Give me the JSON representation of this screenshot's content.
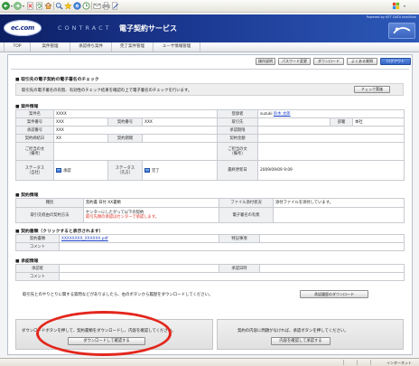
{
  "theme": {
    "header_dark": "#0d1f63",
    "accent_blue": "#3565c8",
    "link": "#1b3fc9",
    "warning_red": "#e02a1f",
    "highlight_ring": "#e3261c"
  },
  "browser": {
    "toolbar_icons": [
      "back-icon",
      "forward-icon",
      "stop-icon",
      "refresh-icon",
      "home-icon",
      "search-icon",
      "favorites-icon",
      "media-icon",
      "history-icon",
      "mail-icon",
      "print-icon",
      "edit-icon",
      "windows-flag-icon"
    ],
    "status_zone": "インターネット"
  },
  "header": {
    "logo": "ec.com",
    "product_prefix": "CONTRACT",
    "product_name": "電子契約サービス",
    "powered_by": "Powered by NTT DATA Intellilink"
  },
  "nav": {
    "tabs": [
      {
        "label": "TOP"
      },
      {
        "label": "案件管理"
      },
      {
        "label": "承認待ち案件"
      },
      {
        "label": "完了案件管理"
      },
      {
        "label": "ユーザ情報管理"
      }
    ]
  },
  "utility": {
    "buttons": [
      {
        "label": "操作説明"
      },
      {
        "label": "パスワード変更"
      },
      {
        "label": "ダウンロード"
      },
      {
        "label": "よくある質問"
      },
      {
        "label": "ログアウト"
      }
    ]
  },
  "signature_check": {
    "heading": "■ 取引先の電子契約の電子署名のチェック",
    "description": "取引先の電子署名の有無、有効性のチェック結果を確認の上で電子署名のチェックを行います。",
    "button": "チェック実施"
  },
  "case_info": {
    "heading": "■ 案件情報",
    "case_name": {
      "label": "案件名",
      "value": "XXXX"
    },
    "registrant": {
      "label": "登録者",
      "id": "suzuki",
      "name": "鈴木 太郎"
    },
    "case_number": {
      "label": "案件番号",
      "value": "XXX"
    },
    "contract_number": {
      "label": "契約番号",
      "value": "XXX"
    },
    "partner": {
      "label": "取引先"
    },
    "department": {
      "label": "部署",
      "value": "本社"
    },
    "approval_number": {
      "label": "承認番号",
      "value": "XXX"
    },
    "approval_deadline": {
      "label": "承認期限"
    },
    "contract_date": {
      "label": "契約締結日",
      "value": "XX"
    },
    "contract_period": {
      "label": "契約期間"
    },
    "contract_amount": {
      "label": "契約金額"
    },
    "note_self": {
      "label": [
        "ご担当の文",
        "（備考）"
      ]
    },
    "note_partner": {
      "label": [
        "ご担当の文",
        "（備考）"
      ]
    },
    "status_self": {
      "label": [
        "ステータス",
        "（自社）"
      ],
      "value": "承認"
    },
    "status_partner": {
      "label": [
        "ステータス",
        "（先方）"
      ],
      "value": "完了"
    },
    "last_updated": {
      "label": "最終更新日",
      "value": "2009/09/09 9:09"
    }
  },
  "contract_info": {
    "heading": "■ 契約情報",
    "type": {
      "label": "種別",
      "value": "契約書 日付 XX書類"
    },
    "attachment": {
      "label": "ファイル添付状況",
      "value": "添付ファイルを添付しています。"
    },
    "method": {
      "label": "取引先経由の契約方法",
      "value": "センターにしたがって以下の契約",
      "warning": "取引先側の承認はセンターで承認します。"
    },
    "signature": {
      "label": "電子署名の有無"
    }
  },
  "documents": {
    "heading": "■ 契約書類（クリックすると表示されます）",
    "file": {
      "label": "契約書類",
      "value": "XXXXXXXX_XXXXXX.pdf"
    },
    "remarks": {
      "label": "特記事項"
    },
    "comment": {
      "label": "コメント"
    }
  },
  "approval_info": {
    "heading": "■ 承認情報",
    "approver": {
      "label": "承認者"
    },
    "approved_at": {
      "label": "承認日時"
    },
    "comment": {
      "label": "コメント"
    }
  },
  "history": {
    "text": "取引先とのやりとりに関する質問などがありましたら、右のボタンから履歴をダウンロードしてください。",
    "button": "承認履歴のダウンロード"
  },
  "actions": {
    "download": {
      "text": "ダウンロードボタンを押して、契約書類をダウンロードし、内容を確認してください。",
      "button": "ダウンロードして確認する"
    },
    "approve": {
      "text": "契約の内容に問題がなければ、承認ボタンを押してください。",
      "button": "内容を確認して承認する"
    }
  }
}
